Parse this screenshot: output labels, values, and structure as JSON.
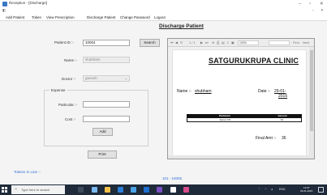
{
  "window": {
    "title": "Reception - [Discharge]",
    "minimize": "–",
    "maximize": "▫",
    "close": "✕"
  },
  "menu": [
    "Add Patient",
    "Token",
    "View Prescription",
    "Discharge Patient",
    "Change Password",
    "Logout"
  ],
  "form": {
    "title": "Discharge Patient",
    "patient_id_label": "Patient ID :-",
    "patient_id_value": "10004",
    "search_label": "Search",
    "name_label": "Name :-",
    "name_value": "shubham",
    "doctor_label": "Doctor :-",
    "doctor_value": "ganesh",
    "expense_group": "Expense",
    "particular_label": "Particular :-",
    "particular_value": "",
    "cost_label": "Cost :-",
    "cost_value": "",
    "add_label": "Add",
    "print_label": "Print"
  },
  "footer": {
    "tokens_link": "Tokens In Line :-",
    "queue_text": "101 - 10006"
  },
  "viewer": {
    "page_indicator": "1 / 1",
    "zoom": "100%",
    "find_label": "Find",
    "next_label": "Next"
  },
  "invoice": {
    "clinic_name": "SATGURUKRUPA CLINIC",
    "name_label": "Name :-",
    "name_value": "shubham",
    "date_label": "Date :-",
    "date_value_line1": "29-01-",
    "date_value_line2": "2016",
    "columns": [
      "Particular",
      "Amount"
    ],
    "rows": [
      [
        "Serum C5",
        "36"
      ]
    ],
    "final_label": "Final Amt :-",
    "final_value": "36"
  },
  "taskbar": {
    "search_placeholder": "Type here to search",
    "tray_text": "ENG",
    "time": "14:07",
    "date": "29-01-2016"
  },
  "colors": {
    "link": "#2f6fd6",
    "taskbar": "#1f2a3a",
    "invoice_header": "#111111"
  }
}
